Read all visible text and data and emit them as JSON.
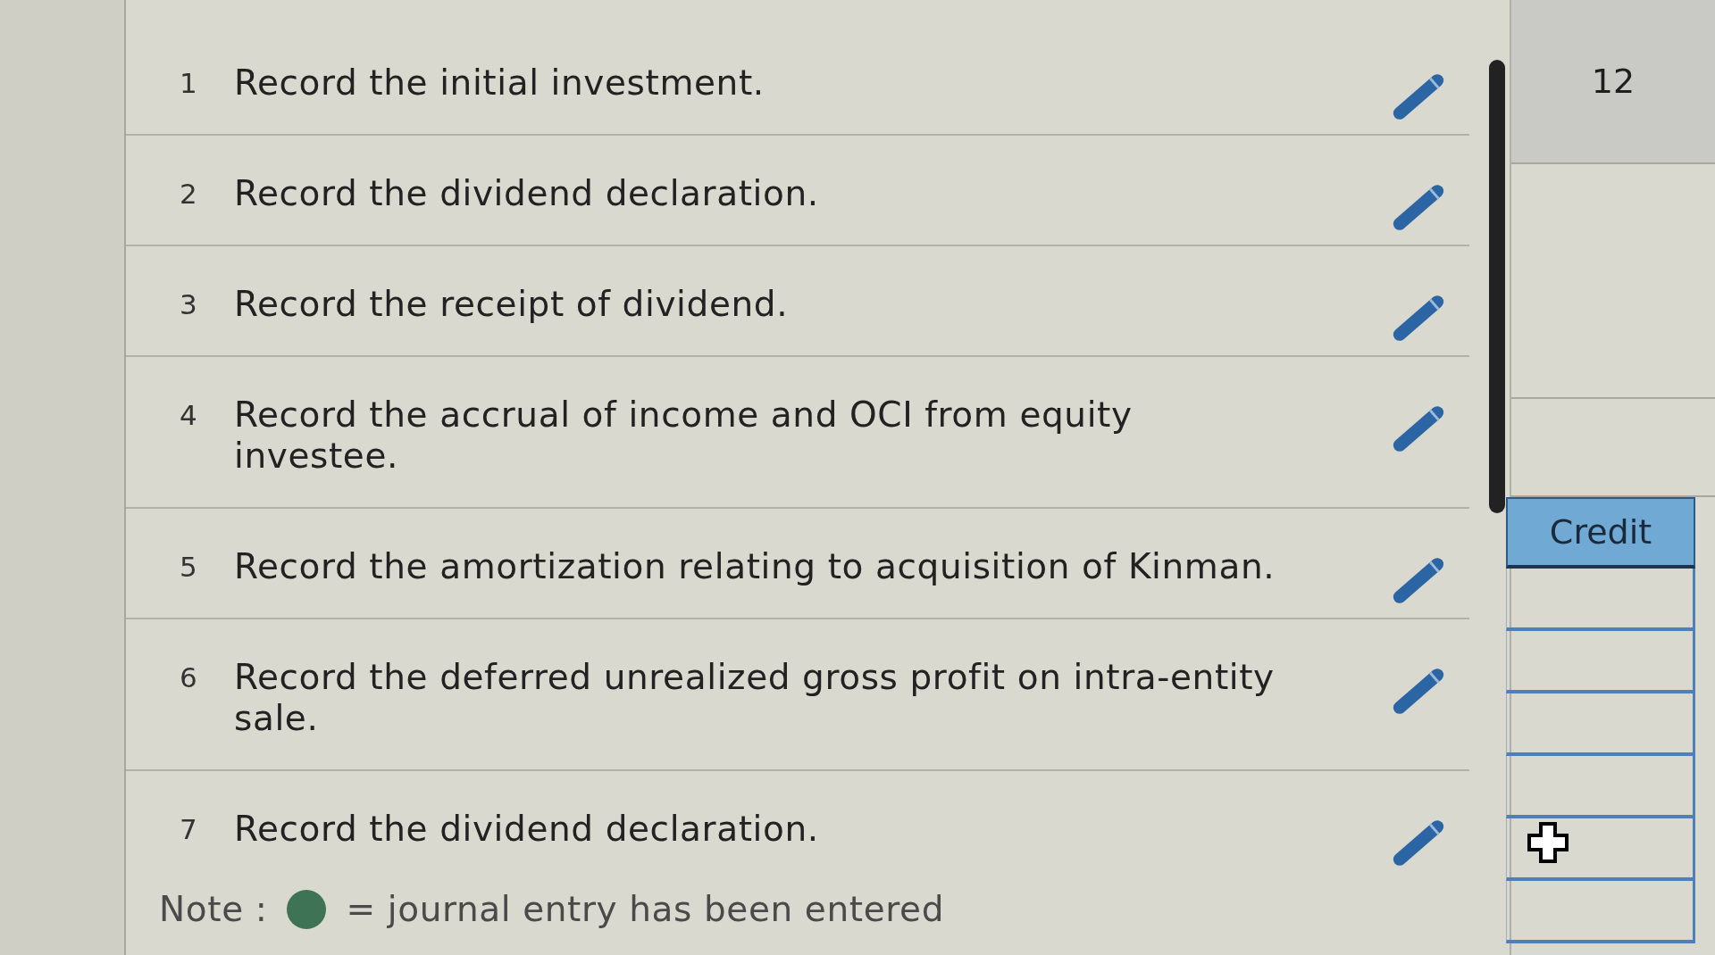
{
  "entries": [
    {
      "number": "1",
      "description": "Record the initial investment."
    },
    {
      "number": "2",
      "description": "Record the dividend declaration."
    },
    {
      "number": "3",
      "description": "Record the receipt of dividend."
    },
    {
      "number": "4",
      "description": "Record the accrual of income and OCI from equity investee."
    },
    {
      "number": "5",
      "description": "Record the amortization relating to acquisition of Kinman."
    },
    {
      "number": "6",
      "description": "Record the deferred unrealized gross profit on intra-entity sale."
    },
    {
      "number": "7",
      "description": "Record the dividend declaration."
    }
  ],
  "side_panel": {
    "top_value": "12",
    "column_header": "Credit"
  },
  "note": {
    "label": "Note :",
    "legend": "= journal entry has been entered"
  }
}
